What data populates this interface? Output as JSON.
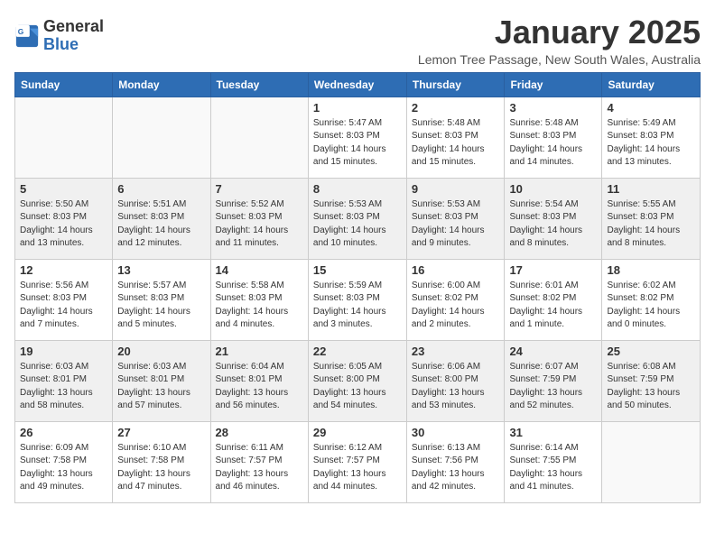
{
  "logo": {
    "text_general": "General",
    "text_blue": "Blue"
  },
  "title": "January 2025",
  "location": "Lemon Tree Passage, New South Wales, Australia",
  "weekdays": [
    "Sunday",
    "Monday",
    "Tuesday",
    "Wednesday",
    "Thursday",
    "Friday",
    "Saturday"
  ],
  "weeks": [
    [
      {
        "day": "",
        "info": ""
      },
      {
        "day": "",
        "info": ""
      },
      {
        "day": "",
        "info": ""
      },
      {
        "day": "1",
        "info": "Sunrise: 5:47 AM\nSunset: 8:03 PM\nDaylight: 14 hours\nand 15 minutes."
      },
      {
        "day": "2",
        "info": "Sunrise: 5:48 AM\nSunset: 8:03 PM\nDaylight: 14 hours\nand 15 minutes."
      },
      {
        "day": "3",
        "info": "Sunrise: 5:48 AM\nSunset: 8:03 PM\nDaylight: 14 hours\nand 14 minutes."
      },
      {
        "day": "4",
        "info": "Sunrise: 5:49 AM\nSunset: 8:03 PM\nDaylight: 14 hours\nand 13 minutes."
      }
    ],
    [
      {
        "day": "5",
        "info": "Sunrise: 5:50 AM\nSunset: 8:03 PM\nDaylight: 14 hours\nand 13 minutes."
      },
      {
        "day": "6",
        "info": "Sunrise: 5:51 AM\nSunset: 8:03 PM\nDaylight: 14 hours\nand 12 minutes."
      },
      {
        "day": "7",
        "info": "Sunrise: 5:52 AM\nSunset: 8:03 PM\nDaylight: 14 hours\nand 11 minutes."
      },
      {
        "day": "8",
        "info": "Sunrise: 5:53 AM\nSunset: 8:03 PM\nDaylight: 14 hours\nand 10 minutes."
      },
      {
        "day": "9",
        "info": "Sunrise: 5:53 AM\nSunset: 8:03 PM\nDaylight: 14 hours\nand 9 minutes."
      },
      {
        "day": "10",
        "info": "Sunrise: 5:54 AM\nSunset: 8:03 PM\nDaylight: 14 hours\nand 8 minutes."
      },
      {
        "day": "11",
        "info": "Sunrise: 5:55 AM\nSunset: 8:03 PM\nDaylight: 14 hours\nand 8 minutes."
      }
    ],
    [
      {
        "day": "12",
        "info": "Sunrise: 5:56 AM\nSunset: 8:03 PM\nDaylight: 14 hours\nand 7 minutes."
      },
      {
        "day": "13",
        "info": "Sunrise: 5:57 AM\nSunset: 8:03 PM\nDaylight: 14 hours\nand 5 minutes."
      },
      {
        "day": "14",
        "info": "Sunrise: 5:58 AM\nSunset: 8:03 PM\nDaylight: 14 hours\nand 4 minutes."
      },
      {
        "day": "15",
        "info": "Sunrise: 5:59 AM\nSunset: 8:03 PM\nDaylight: 14 hours\nand 3 minutes."
      },
      {
        "day": "16",
        "info": "Sunrise: 6:00 AM\nSunset: 8:02 PM\nDaylight: 14 hours\nand 2 minutes."
      },
      {
        "day": "17",
        "info": "Sunrise: 6:01 AM\nSunset: 8:02 PM\nDaylight: 14 hours\nand 1 minute."
      },
      {
        "day": "18",
        "info": "Sunrise: 6:02 AM\nSunset: 8:02 PM\nDaylight: 14 hours\nand 0 minutes."
      }
    ],
    [
      {
        "day": "19",
        "info": "Sunrise: 6:03 AM\nSunset: 8:01 PM\nDaylight: 13 hours\nand 58 minutes."
      },
      {
        "day": "20",
        "info": "Sunrise: 6:03 AM\nSunset: 8:01 PM\nDaylight: 13 hours\nand 57 minutes."
      },
      {
        "day": "21",
        "info": "Sunrise: 6:04 AM\nSunset: 8:01 PM\nDaylight: 13 hours\nand 56 minutes."
      },
      {
        "day": "22",
        "info": "Sunrise: 6:05 AM\nSunset: 8:00 PM\nDaylight: 13 hours\nand 54 minutes."
      },
      {
        "day": "23",
        "info": "Sunrise: 6:06 AM\nSunset: 8:00 PM\nDaylight: 13 hours\nand 53 minutes."
      },
      {
        "day": "24",
        "info": "Sunrise: 6:07 AM\nSunset: 7:59 PM\nDaylight: 13 hours\nand 52 minutes."
      },
      {
        "day": "25",
        "info": "Sunrise: 6:08 AM\nSunset: 7:59 PM\nDaylight: 13 hours\nand 50 minutes."
      }
    ],
    [
      {
        "day": "26",
        "info": "Sunrise: 6:09 AM\nSunset: 7:58 PM\nDaylight: 13 hours\nand 49 minutes."
      },
      {
        "day": "27",
        "info": "Sunrise: 6:10 AM\nSunset: 7:58 PM\nDaylight: 13 hours\nand 47 minutes."
      },
      {
        "day": "28",
        "info": "Sunrise: 6:11 AM\nSunset: 7:57 PM\nDaylight: 13 hours\nand 46 minutes."
      },
      {
        "day": "29",
        "info": "Sunrise: 6:12 AM\nSunset: 7:57 PM\nDaylight: 13 hours\nand 44 minutes."
      },
      {
        "day": "30",
        "info": "Sunrise: 6:13 AM\nSunset: 7:56 PM\nDaylight: 13 hours\nand 42 minutes."
      },
      {
        "day": "31",
        "info": "Sunrise: 6:14 AM\nSunset: 7:55 PM\nDaylight: 13 hours\nand 41 minutes."
      },
      {
        "day": "",
        "info": ""
      }
    ]
  ]
}
